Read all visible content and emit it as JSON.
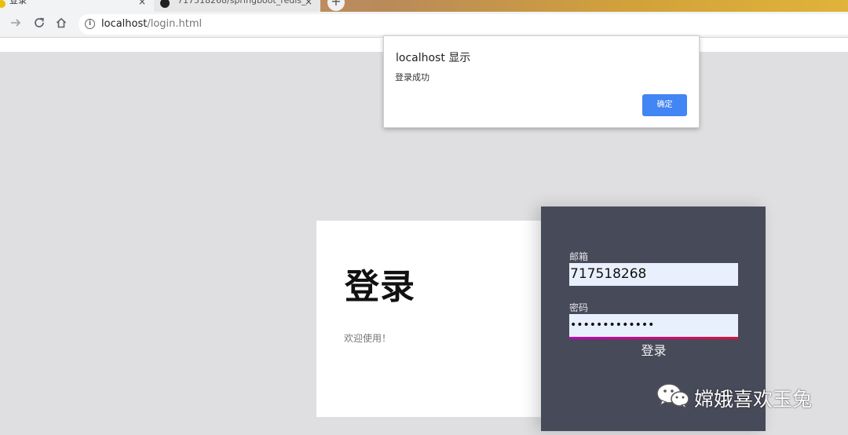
{
  "browser": {
    "tabs": [
      {
        "title": "登录",
        "active": true
      },
      {
        "title": "717518268/springboot_redis_",
        "active": false
      }
    ],
    "close_glyph": "×",
    "newtab_glyph": "+",
    "url_host": "localhost",
    "url_path": "/login.html"
  },
  "dialog": {
    "title": "localhost 显示",
    "message": "登录成功",
    "ok_label": "确定",
    "ok_color": "#4285f4"
  },
  "login": {
    "heading": "登录",
    "welcome": "欢迎使用！",
    "email_label": "邮箱",
    "email_value": "717518268",
    "password_label": "密码",
    "password_value": "•••••••••••••",
    "button_label": "登录",
    "panel_color": "#474a59",
    "underline_gradient": [
      "#c000c0",
      "#e0103a"
    ]
  },
  "watermark": {
    "text": "嫦娥喜欢玉兔",
    "icon": "wechat-icon"
  }
}
